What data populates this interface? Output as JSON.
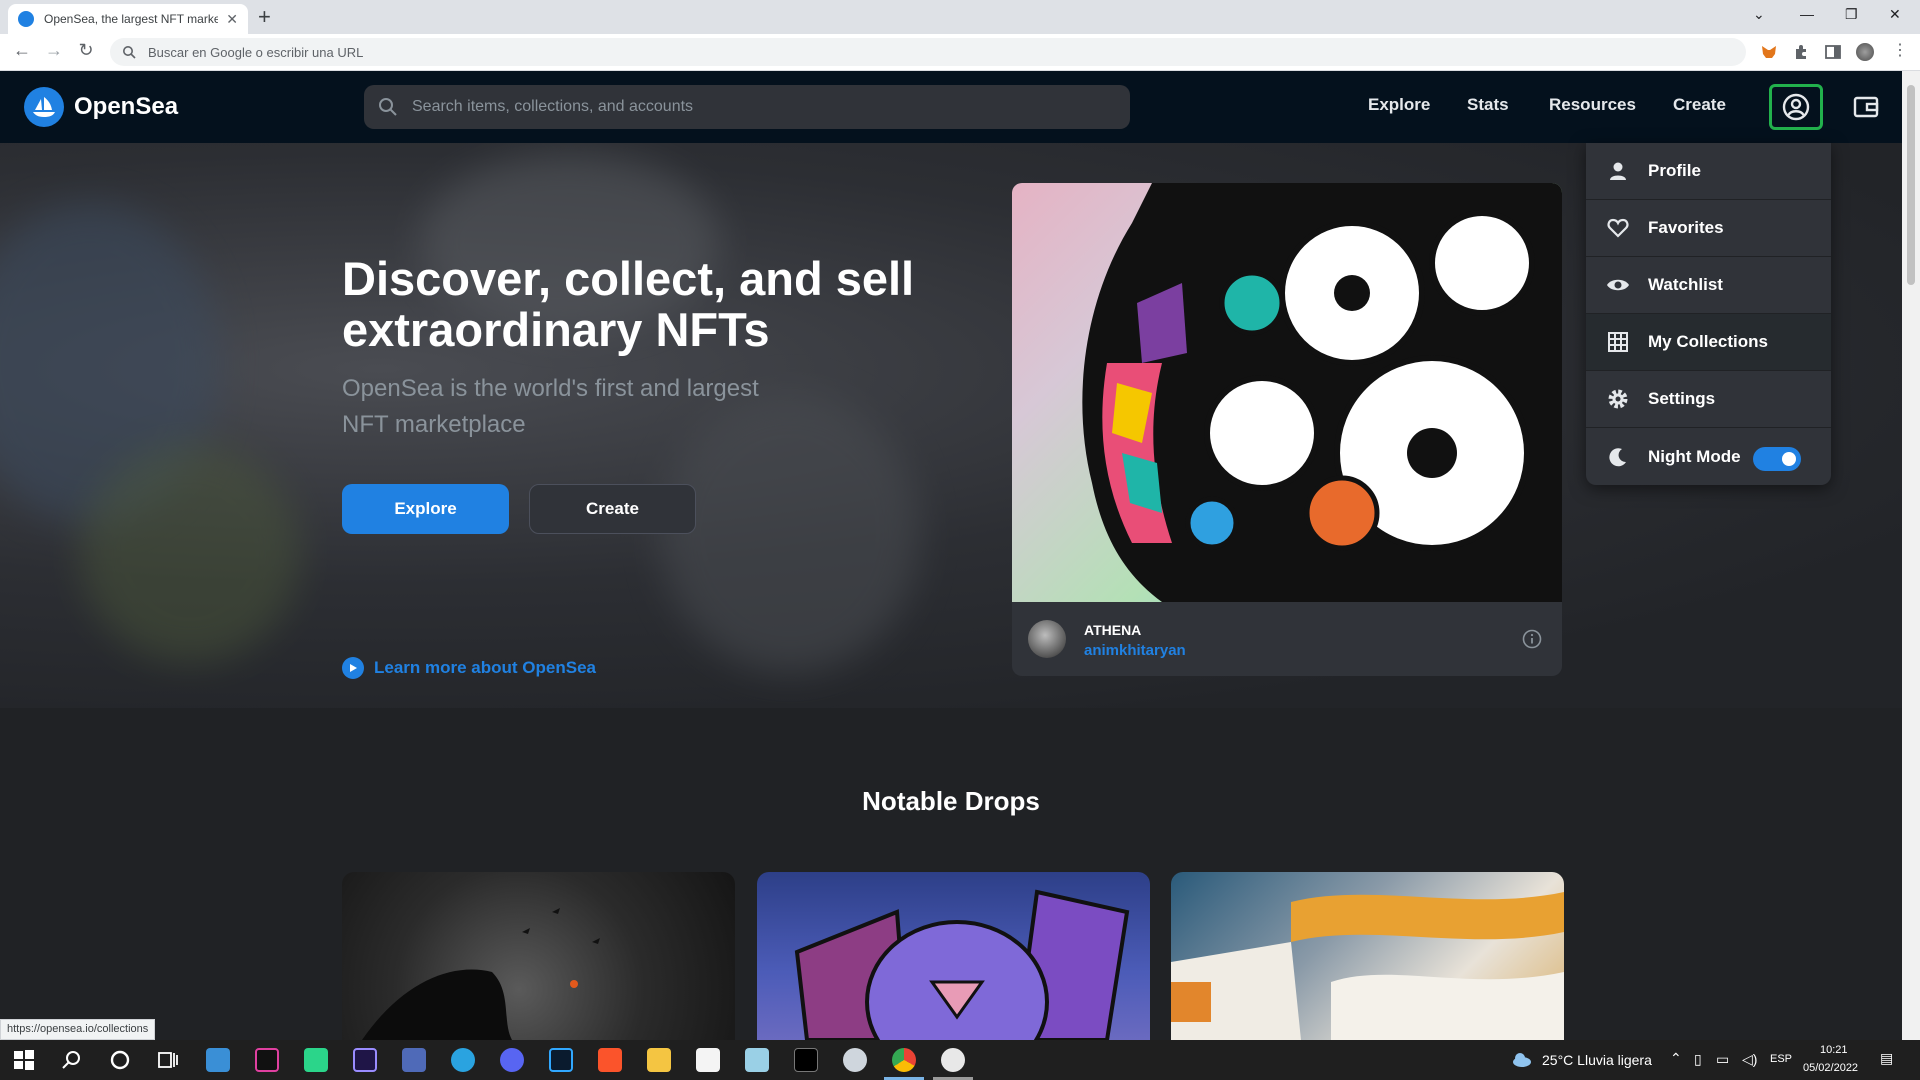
{
  "browser": {
    "tab_title": "OpenSea, the largest NFT marketplace",
    "omnibox_placeholder": "Buscar en Google o escribir una URL",
    "status_url": "https://opensea.io/collections"
  },
  "nav": {
    "brand": "OpenSea",
    "search_placeholder": "Search items, collections, and accounts",
    "links": [
      "Explore",
      "Stats",
      "Resources",
      "Create"
    ]
  },
  "hero": {
    "title": "Discover, collect, and sell extraordinary NFTs",
    "subtitle": "OpenSea is the world's first and largest NFT marketplace",
    "explore_label": "Explore",
    "create_label": "Create",
    "learn_more": "Learn more about OpenSea"
  },
  "featured": {
    "name": "ATHENA",
    "creator": "animkhitaryan"
  },
  "account_menu": {
    "items": [
      {
        "label": "Profile",
        "icon": "user-icon"
      },
      {
        "label": "Favorites",
        "icon": "heart-icon"
      },
      {
        "label": "Watchlist",
        "icon": "eye-icon"
      },
      {
        "label": "My Collections",
        "icon": "grid-icon"
      },
      {
        "label": "Settings",
        "icon": "gear-icon"
      },
      {
        "label": "Night Mode",
        "icon": "moon-icon"
      }
    ],
    "night_mode_on": true
  },
  "sections": {
    "notable_drops_title": "Notable Drops"
  },
  "taskbar": {
    "weather": "25°C  Lluvia ligera",
    "language": "ESP",
    "time": "10:21",
    "date": "05/02/2022"
  },
  "colors": {
    "accent": "#2081e2",
    "nav_bg": "#04111d",
    "menu_bg": "#303339",
    "highlight": "#22b14c"
  }
}
